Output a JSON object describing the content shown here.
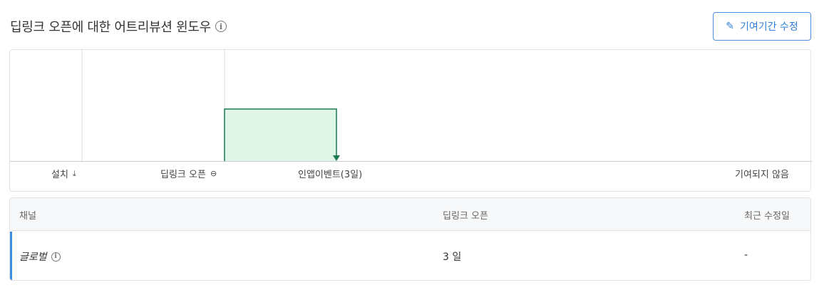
{
  "header": {
    "title": "딥링크 오픈에 대한 어트리뷰션 윈도우",
    "info_icon": "ⓘ",
    "edit_label": "기여기간 수정",
    "edit_icon": "pencil-icon"
  },
  "timeline": {
    "labels": [
      {
        "text": "설치",
        "icon": "download-icon",
        "glyph": "⤓"
      },
      {
        "text": "딥링크 오픈",
        "icon": "link-icon",
        "glyph": "⊖"
      },
      {
        "text": "인앱이벤트(3일)"
      },
      {
        "text": "기여되지 않음"
      }
    ],
    "window_days": 3,
    "colors": {
      "fill": "#dff5e8",
      "stroke": "#1b7a4f",
      "axis": "#cccccc",
      "divider": "#dddddd"
    }
  },
  "table": {
    "columns": [
      "채널",
      "딥링크 오픈",
      "최근 수정일"
    ],
    "rows": [
      {
        "channel": "글로벌",
        "deeplink_open": "3 일",
        "last_modified": "-"
      }
    ]
  }
}
